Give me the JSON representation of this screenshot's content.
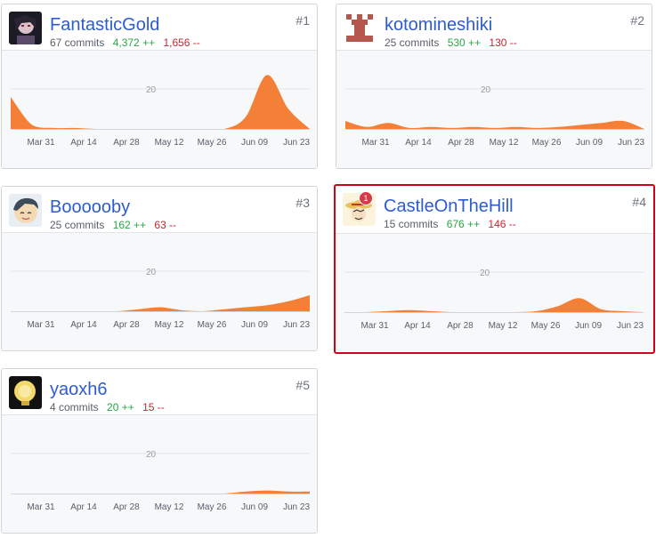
{
  "ui": {
    "colors": {
      "link": "#2d5bd1",
      "additions": "#28a745",
      "deletions": "#cb2431",
      "area": "#f47f36",
      "highlight_border": "#d0021b"
    },
    "x_ticks": [
      "Mar 31",
      "Apr 14",
      "Apr 28",
      "May 12",
      "May 26",
      "Jun 09",
      "Jun 23"
    ],
    "y_gridline_label": "20"
  },
  "contributors": [
    {
      "rank": "#1",
      "name": "FantasticGold",
      "commits": "67 commits",
      "additions": "4,372 ++",
      "deletions": "1,656 --",
      "avatar_icon": "dark-anime-avatar-icon",
      "highlighted": false,
      "badge": "",
      "chart_data": {
        "type": "area",
        "x": [
          "Mar 24",
          "Mar 31",
          "Apr 07",
          "Apr 14",
          "Apr 21",
          "Apr 28",
          "May 05",
          "May 12",
          "May 19",
          "May 26",
          "Jun 02",
          "Jun 09",
          "Jun 16",
          "Jun 23",
          "Jun 30"
        ],
        "values": [
          16,
          2,
          0.5,
          0.5,
          0,
          0,
          0,
          0,
          0,
          0,
          0,
          6,
          27,
          10,
          0
        ],
        "ylim": [
          0,
          40
        ],
        "grid_label": "20"
      }
    },
    {
      "rank": "#2",
      "name": "kotomineshiki",
      "commits": "25 commits",
      "additions": "530 ++",
      "deletions": "130 --",
      "avatar_icon": "pixel-castle-avatar-icon",
      "highlighted": false,
      "badge": "",
      "chart_data": {
        "type": "area",
        "x": [
          "Mar 24",
          "Mar 31",
          "Apr 07",
          "Apr 14",
          "Apr 21",
          "Apr 28",
          "May 05",
          "May 12",
          "May 19",
          "May 26",
          "Jun 02",
          "Jun 09",
          "Jun 16",
          "Jun 23",
          "Jun 30"
        ],
        "values": [
          4,
          1,
          3,
          0.5,
          1,
          0.5,
          1,
          0.5,
          1,
          0.5,
          1,
          2,
          3,
          4,
          0
        ],
        "ylim": [
          0,
          40
        ],
        "grid_label": "20"
      }
    },
    {
      "rank": "#3",
      "name": "Boooooby",
      "commits": "25 commits",
      "additions": "162 ++",
      "deletions": "63 --",
      "avatar_icon": "cartoon-face-avatar-icon",
      "highlighted": false,
      "badge": "",
      "chart_data": {
        "type": "area",
        "x": [
          "Mar 24",
          "Mar 31",
          "Apr 07",
          "Apr 14",
          "Apr 21",
          "Apr 28",
          "May 05",
          "May 12",
          "May 19",
          "May 26",
          "Jun 02",
          "Jun 09",
          "Jun 16",
          "Jun 23",
          "Jun 30"
        ],
        "values": [
          0,
          0,
          0,
          0,
          0,
          0,
          1,
          2,
          0.5,
          0,
          1,
          2,
          3,
          5,
          8
        ],
        "ylim": [
          0,
          40
        ],
        "grid_label": "20"
      }
    },
    {
      "rank": "#4",
      "name": "CastleOnTheHill",
      "commits": "15 commits",
      "additions": "676 ++",
      "deletions": "146 --",
      "avatar_icon": "straw-hat-avatar-icon",
      "highlighted": true,
      "badge": "1",
      "chart_data": {
        "type": "area",
        "x": [
          "Mar 24",
          "Mar 31",
          "Apr 07",
          "Apr 14",
          "Apr 21",
          "Apr 28",
          "May 05",
          "May 12",
          "May 19",
          "May 26",
          "Jun 02",
          "Jun 09",
          "Jun 16",
          "Jun 23",
          "Jun 30"
        ],
        "values": [
          0,
          0,
          0.5,
          1,
          0.5,
          0,
          0,
          0,
          0,
          0.5,
          3,
          7,
          1.5,
          0.5,
          0
        ],
        "ylim": [
          0,
          40
        ],
        "grid_label": "20"
      }
    },
    {
      "rank": "#5",
      "name": "yaoxh6",
      "commits": "4 commits",
      "additions": "20 ++",
      "deletions": "15 --",
      "avatar_icon": "yellow-lightbulb-avatar-icon",
      "highlighted": false,
      "badge": "",
      "chart_data": {
        "type": "area",
        "x": [
          "Mar 24",
          "Mar 31",
          "Apr 07",
          "Apr 14",
          "Apr 21",
          "Apr 28",
          "May 05",
          "May 12",
          "May 19",
          "May 26",
          "Jun 02",
          "Jun 09",
          "Jun 16",
          "Jun 23",
          "Jun 30"
        ],
        "values": [
          0,
          0,
          0,
          0,
          0,
          0,
          0,
          0,
          0,
          0,
          0,
          1,
          1.5,
          1,
          1
        ],
        "ylim": [
          0,
          40
        ],
        "grid_label": "20"
      }
    }
  ]
}
